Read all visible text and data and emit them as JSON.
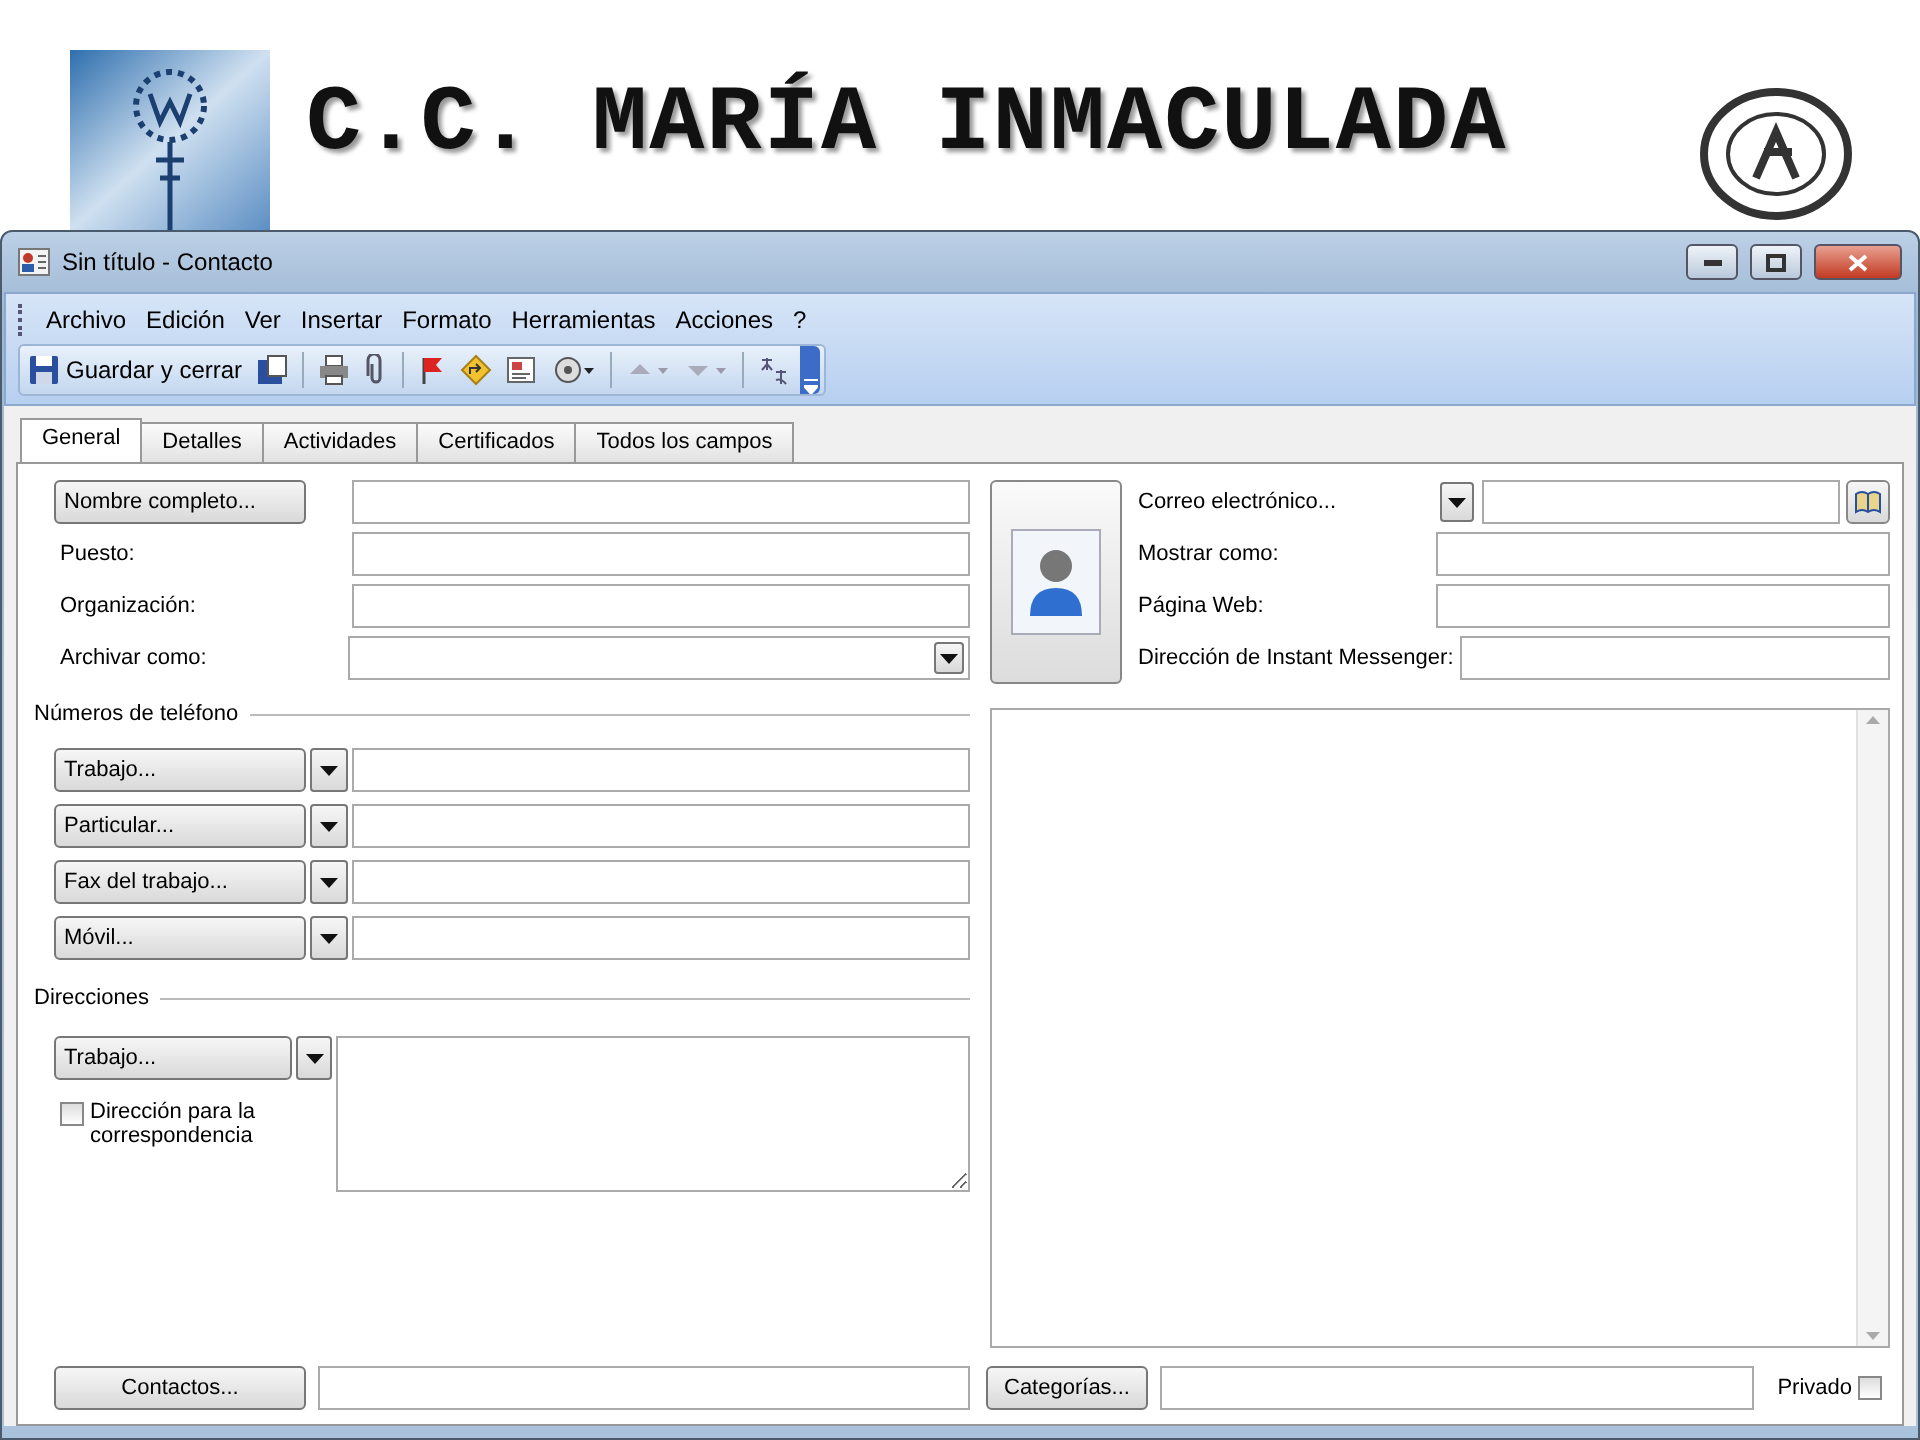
{
  "slide": {
    "title": "C.C. MARÍA INMACULADA"
  },
  "window": {
    "title": "Sin título - Contacto"
  },
  "menu": [
    "Archivo",
    "Edición",
    "Ver",
    "Insertar",
    "Formato",
    "Herramientas",
    "Acciones",
    "?"
  ],
  "toolbar": {
    "save_label": "Guardar y cerrar"
  },
  "tabs": [
    {
      "label": "General",
      "selected": true
    },
    {
      "label": "Detalles",
      "selected": false
    },
    {
      "label": "Actividades",
      "selected": false
    },
    {
      "label": "Certificados",
      "selected": false
    },
    {
      "label": "Todos los campos",
      "selected": false
    }
  ],
  "name_button": "Nombre completo...",
  "fields": [
    {
      "label": "Puesto:",
      "kind": "text"
    },
    {
      "label": "Organización:",
      "kind": "text"
    },
    {
      "label": "Archivar como:",
      "kind": "dropdown"
    }
  ],
  "phones": {
    "heading": "Números de teléfono",
    "buttons": [
      "Trabajo...",
      "Particular...",
      "Fax del trabajo...",
      "Móvil..."
    ]
  },
  "addresses": {
    "heading": "Direcciones",
    "button": "Trabajo...",
    "mailing": {
      "label": "Dirección para la correspondencia",
      "checked": false
    }
  },
  "email_button": "Correo electrónico...",
  "right_fields": [
    "Mostrar como:",
    "Página Web:",
    "Dirección de Instant Messenger:"
  ],
  "footer": {
    "contacts_button": "Contactos...",
    "categories_button": "Categorías...",
    "private": {
      "label": "Privado",
      "checked": false
    }
  }
}
